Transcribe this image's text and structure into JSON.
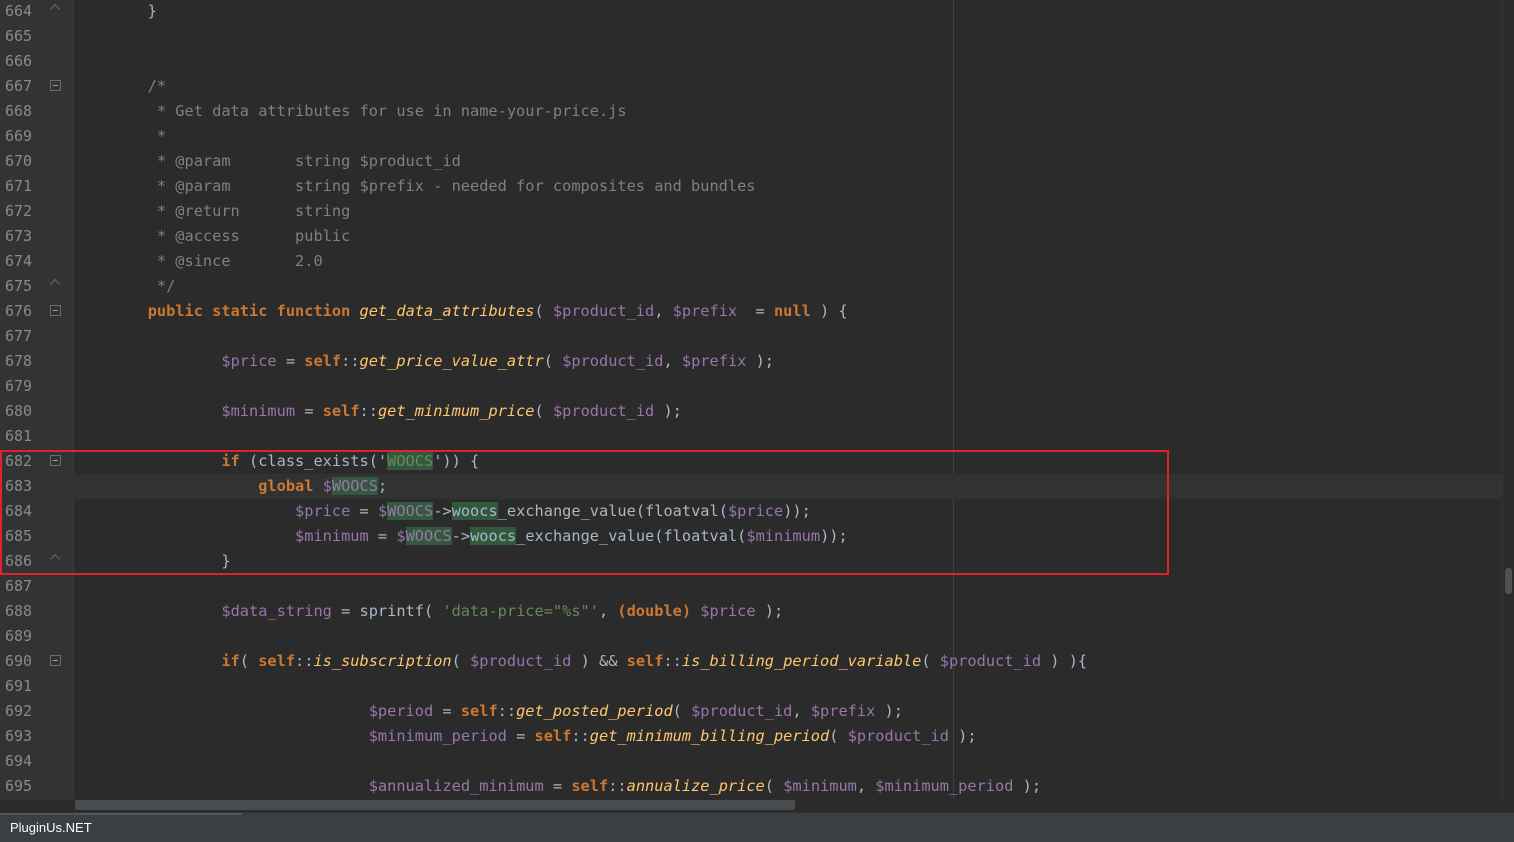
{
  "editor": {
    "lines": [
      {
        "num": "664",
        "tokens": [
          [
            "op",
            "        }"
          ]
        ]
      },
      {
        "num": "665",
        "tokens": []
      },
      {
        "num": "666",
        "tokens": []
      },
      {
        "num": "667",
        "tokens": [
          [
            "cm",
            "        /*"
          ]
        ]
      },
      {
        "num": "668",
        "tokens": [
          [
            "cm",
            "         * Get data attributes for use in name-your-price.js"
          ]
        ]
      },
      {
        "num": "669",
        "tokens": [
          [
            "cm",
            "         *"
          ]
        ]
      },
      {
        "num": "670",
        "tokens": [
          [
            "cm",
            "         * @param       string $product_id"
          ]
        ]
      },
      {
        "num": "671",
        "tokens": [
          [
            "cm",
            "         * @param       string $prefix - needed for composites and bundles"
          ]
        ]
      },
      {
        "num": "672",
        "tokens": [
          [
            "cm",
            "         * @return      string"
          ]
        ]
      },
      {
        "num": "673",
        "tokens": [
          [
            "cm",
            "         * @access      public"
          ]
        ]
      },
      {
        "num": "674",
        "tokens": [
          [
            "cm",
            "         * @since       2.0"
          ]
        ]
      },
      {
        "num": "675",
        "tokens": [
          [
            "cm",
            "         */"
          ]
        ]
      },
      {
        "num": "676",
        "tokens": [
          [
            "op",
            "        "
          ],
          [
            "kw",
            "public static function "
          ],
          [
            "fn",
            "get_data_attributes"
          ],
          [
            "op",
            "( "
          ],
          [
            "var",
            "$product_id"
          ],
          [
            "op",
            ", "
          ],
          [
            "var",
            "$prefix"
          ],
          [
            "op",
            "  = "
          ],
          [
            "kw",
            "null"
          ],
          [
            "op",
            " ) {"
          ]
        ]
      },
      {
        "num": "677",
        "tokens": []
      },
      {
        "num": "678",
        "tokens": [
          [
            "op",
            "                "
          ],
          [
            "var",
            "$price"
          ],
          [
            "op",
            " = "
          ],
          [
            "kw",
            "self"
          ],
          [
            "op",
            "::"
          ],
          [
            "fn",
            "get_price_value_attr"
          ],
          [
            "op",
            "( "
          ],
          [
            "var",
            "$product_id"
          ],
          [
            "op",
            ", "
          ],
          [
            "var",
            "$prefix"
          ],
          [
            "op",
            " );"
          ]
        ]
      },
      {
        "num": "679",
        "tokens": []
      },
      {
        "num": "680",
        "tokens": [
          [
            "op",
            "                "
          ],
          [
            "var",
            "$minimum"
          ],
          [
            "op",
            " = "
          ],
          [
            "kw",
            "self"
          ],
          [
            "op",
            "::"
          ],
          [
            "fn",
            "get_minimum_price"
          ],
          [
            "op",
            "( "
          ],
          [
            "var",
            "$product_id"
          ],
          [
            "op",
            " );"
          ]
        ]
      },
      {
        "num": "681",
        "tokens": []
      },
      {
        "num": "682",
        "tokens": [
          [
            "op",
            "                "
          ],
          [
            "kw",
            "if"
          ],
          [
            "op",
            " (class_exists('"
          ],
          [
            "str hl",
            "WOOCS"
          ],
          [
            "op",
            "')) {"
          ]
        ]
      },
      {
        "num": "683",
        "tokens": [
          [
            "op",
            "                    "
          ],
          [
            "kw",
            "global "
          ],
          [
            "var",
            "$"
          ],
          [
            "var hl",
            "WOOCS"
          ],
          [
            "op",
            ";"
          ]
        ]
      },
      {
        "num": "684",
        "tokens": [
          [
            "op",
            "                        "
          ],
          [
            "var",
            "$price"
          ],
          [
            "op",
            " = "
          ],
          [
            "var",
            "$"
          ],
          [
            "var hl",
            "WOOCS"
          ],
          [
            "op",
            "->"
          ],
          [
            "op hl",
            "woocs"
          ],
          [
            "op",
            "_exchange_value(floatval("
          ],
          [
            "var",
            "$price"
          ],
          [
            "op",
            "));"
          ]
        ]
      },
      {
        "num": "685",
        "tokens": [
          [
            "op",
            "                        "
          ],
          [
            "var",
            "$minimum"
          ],
          [
            "op",
            " = "
          ],
          [
            "var",
            "$"
          ],
          [
            "var hl",
            "WOOCS"
          ],
          [
            "op",
            "->"
          ],
          [
            "op hl",
            "woocs"
          ],
          [
            "op",
            "_exchange_value(floatval("
          ],
          [
            "var",
            "$minimum"
          ],
          [
            "op",
            "));"
          ]
        ]
      },
      {
        "num": "686",
        "tokens": [
          [
            "op",
            "                }"
          ]
        ]
      },
      {
        "num": "687",
        "tokens": []
      },
      {
        "num": "688",
        "tokens": [
          [
            "op",
            "                "
          ],
          [
            "var",
            "$data_string"
          ],
          [
            "op",
            " = sprintf( "
          ],
          [
            "str",
            "'data-price=\"%s\"'"
          ],
          [
            "op",
            ", "
          ],
          [
            "kw",
            "(double)"
          ],
          [
            "op",
            " "
          ],
          [
            "var",
            "$price"
          ],
          [
            "op",
            " );"
          ]
        ]
      },
      {
        "num": "689",
        "tokens": []
      },
      {
        "num": "690",
        "tokens": [
          [
            "op",
            "                "
          ],
          [
            "kw",
            "if"
          ],
          [
            "op",
            "( "
          ],
          [
            "kw",
            "self"
          ],
          [
            "op",
            "::"
          ],
          [
            "fn",
            "is_subscription"
          ],
          [
            "op",
            "( "
          ],
          [
            "var",
            "$product_id"
          ],
          [
            "op",
            " ) && "
          ],
          [
            "kw",
            "self"
          ],
          [
            "op",
            "::"
          ],
          [
            "fn",
            "is_billing_period_variable"
          ],
          [
            "op",
            "( "
          ],
          [
            "var",
            "$product_id"
          ],
          [
            "op",
            " ) ){"
          ]
        ]
      },
      {
        "num": "691",
        "tokens": []
      },
      {
        "num": "692",
        "tokens": [
          [
            "op",
            "                                "
          ],
          [
            "var",
            "$period"
          ],
          [
            "op",
            " = "
          ],
          [
            "kw",
            "self"
          ],
          [
            "op",
            "::"
          ],
          [
            "fn",
            "get_posted_period"
          ],
          [
            "op",
            "( "
          ],
          [
            "var",
            "$product_id"
          ],
          [
            "op",
            ", "
          ],
          [
            "var",
            "$prefix"
          ],
          [
            "op",
            " );"
          ]
        ]
      },
      {
        "num": "693",
        "tokens": [
          [
            "op",
            "                                "
          ],
          [
            "var",
            "$minimum_period"
          ],
          [
            "op",
            " = "
          ],
          [
            "kw",
            "self"
          ],
          [
            "op",
            "::"
          ],
          [
            "fn",
            "get_minimum_billing_period"
          ],
          [
            "op",
            "( "
          ],
          [
            "var",
            "$product_id"
          ],
          [
            "op",
            " );"
          ]
        ]
      },
      {
        "num": "694",
        "tokens": []
      },
      {
        "num": "695",
        "tokens": [
          [
            "op",
            "                                "
          ],
          [
            "var",
            "$annualized_minimum"
          ],
          [
            "op",
            " = "
          ],
          [
            "kw",
            "self"
          ],
          [
            "op",
            "::"
          ],
          [
            "fn",
            "annualize_price"
          ],
          [
            "op",
            "( "
          ],
          [
            "var",
            "$minimum"
          ],
          [
            "op",
            ", "
          ],
          [
            "var",
            "$minimum_period"
          ],
          [
            "op",
            " );"
          ]
        ]
      }
    ],
    "fold_start_lines": [
      "667",
      "676",
      "682",
      "690"
    ],
    "fold_end_lines": [
      "664",
      "675",
      "686"
    ],
    "caret_line": "683"
  },
  "status_bar": {
    "label": "PluginUs.NET"
  }
}
